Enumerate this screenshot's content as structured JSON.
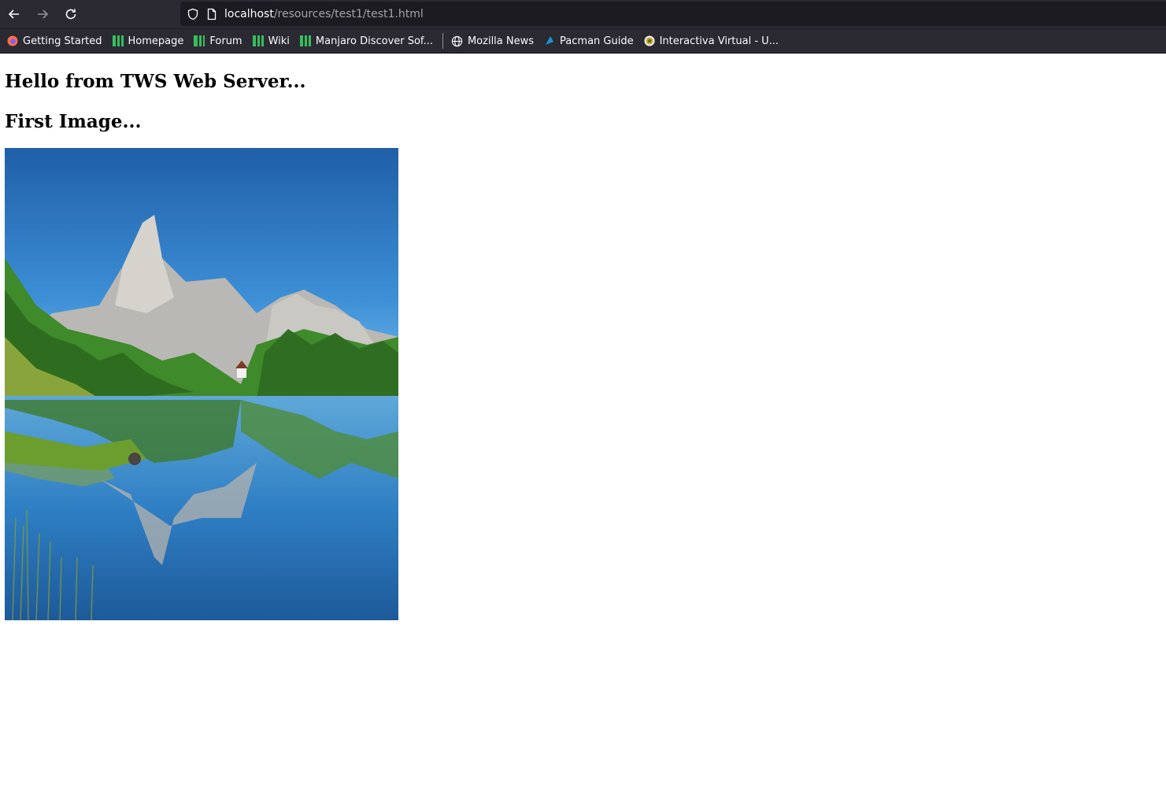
{
  "browser": {
    "url_host": "localhost",
    "url_path": "/resources/test1/test1.html",
    "bookmarks": [
      {
        "label": "Getting Started",
        "icon": "firefox-icon"
      },
      {
        "label": "Homepage",
        "icon": "manjaro-icon"
      },
      {
        "label": "Forum",
        "icon": "manjaro-icon"
      },
      {
        "label": "Wiki",
        "icon": "manjaro-icon"
      },
      {
        "label": "Manjaro Discover Sof...",
        "icon": "manjaro-icon"
      },
      {
        "label": "Mozilla News",
        "icon": "globe-icon"
      },
      {
        "label": "Pacman Guide",
        "icon": "pacman-icon"
      },
      {
        "label": "Interactiva Virtual - U...",
        "icon": "site-icon"
      }
    ]
  },
  "page": {
    "heading": "Hello from TWS Web Server...",
    "subheading": "First Image..."
  },
  "colors": {
    "chrome_bg": "#2b2a33",
    "urlbar_bg": "#1c1b22",
    "manjaro_green": "#35bf5c"
  }
}
